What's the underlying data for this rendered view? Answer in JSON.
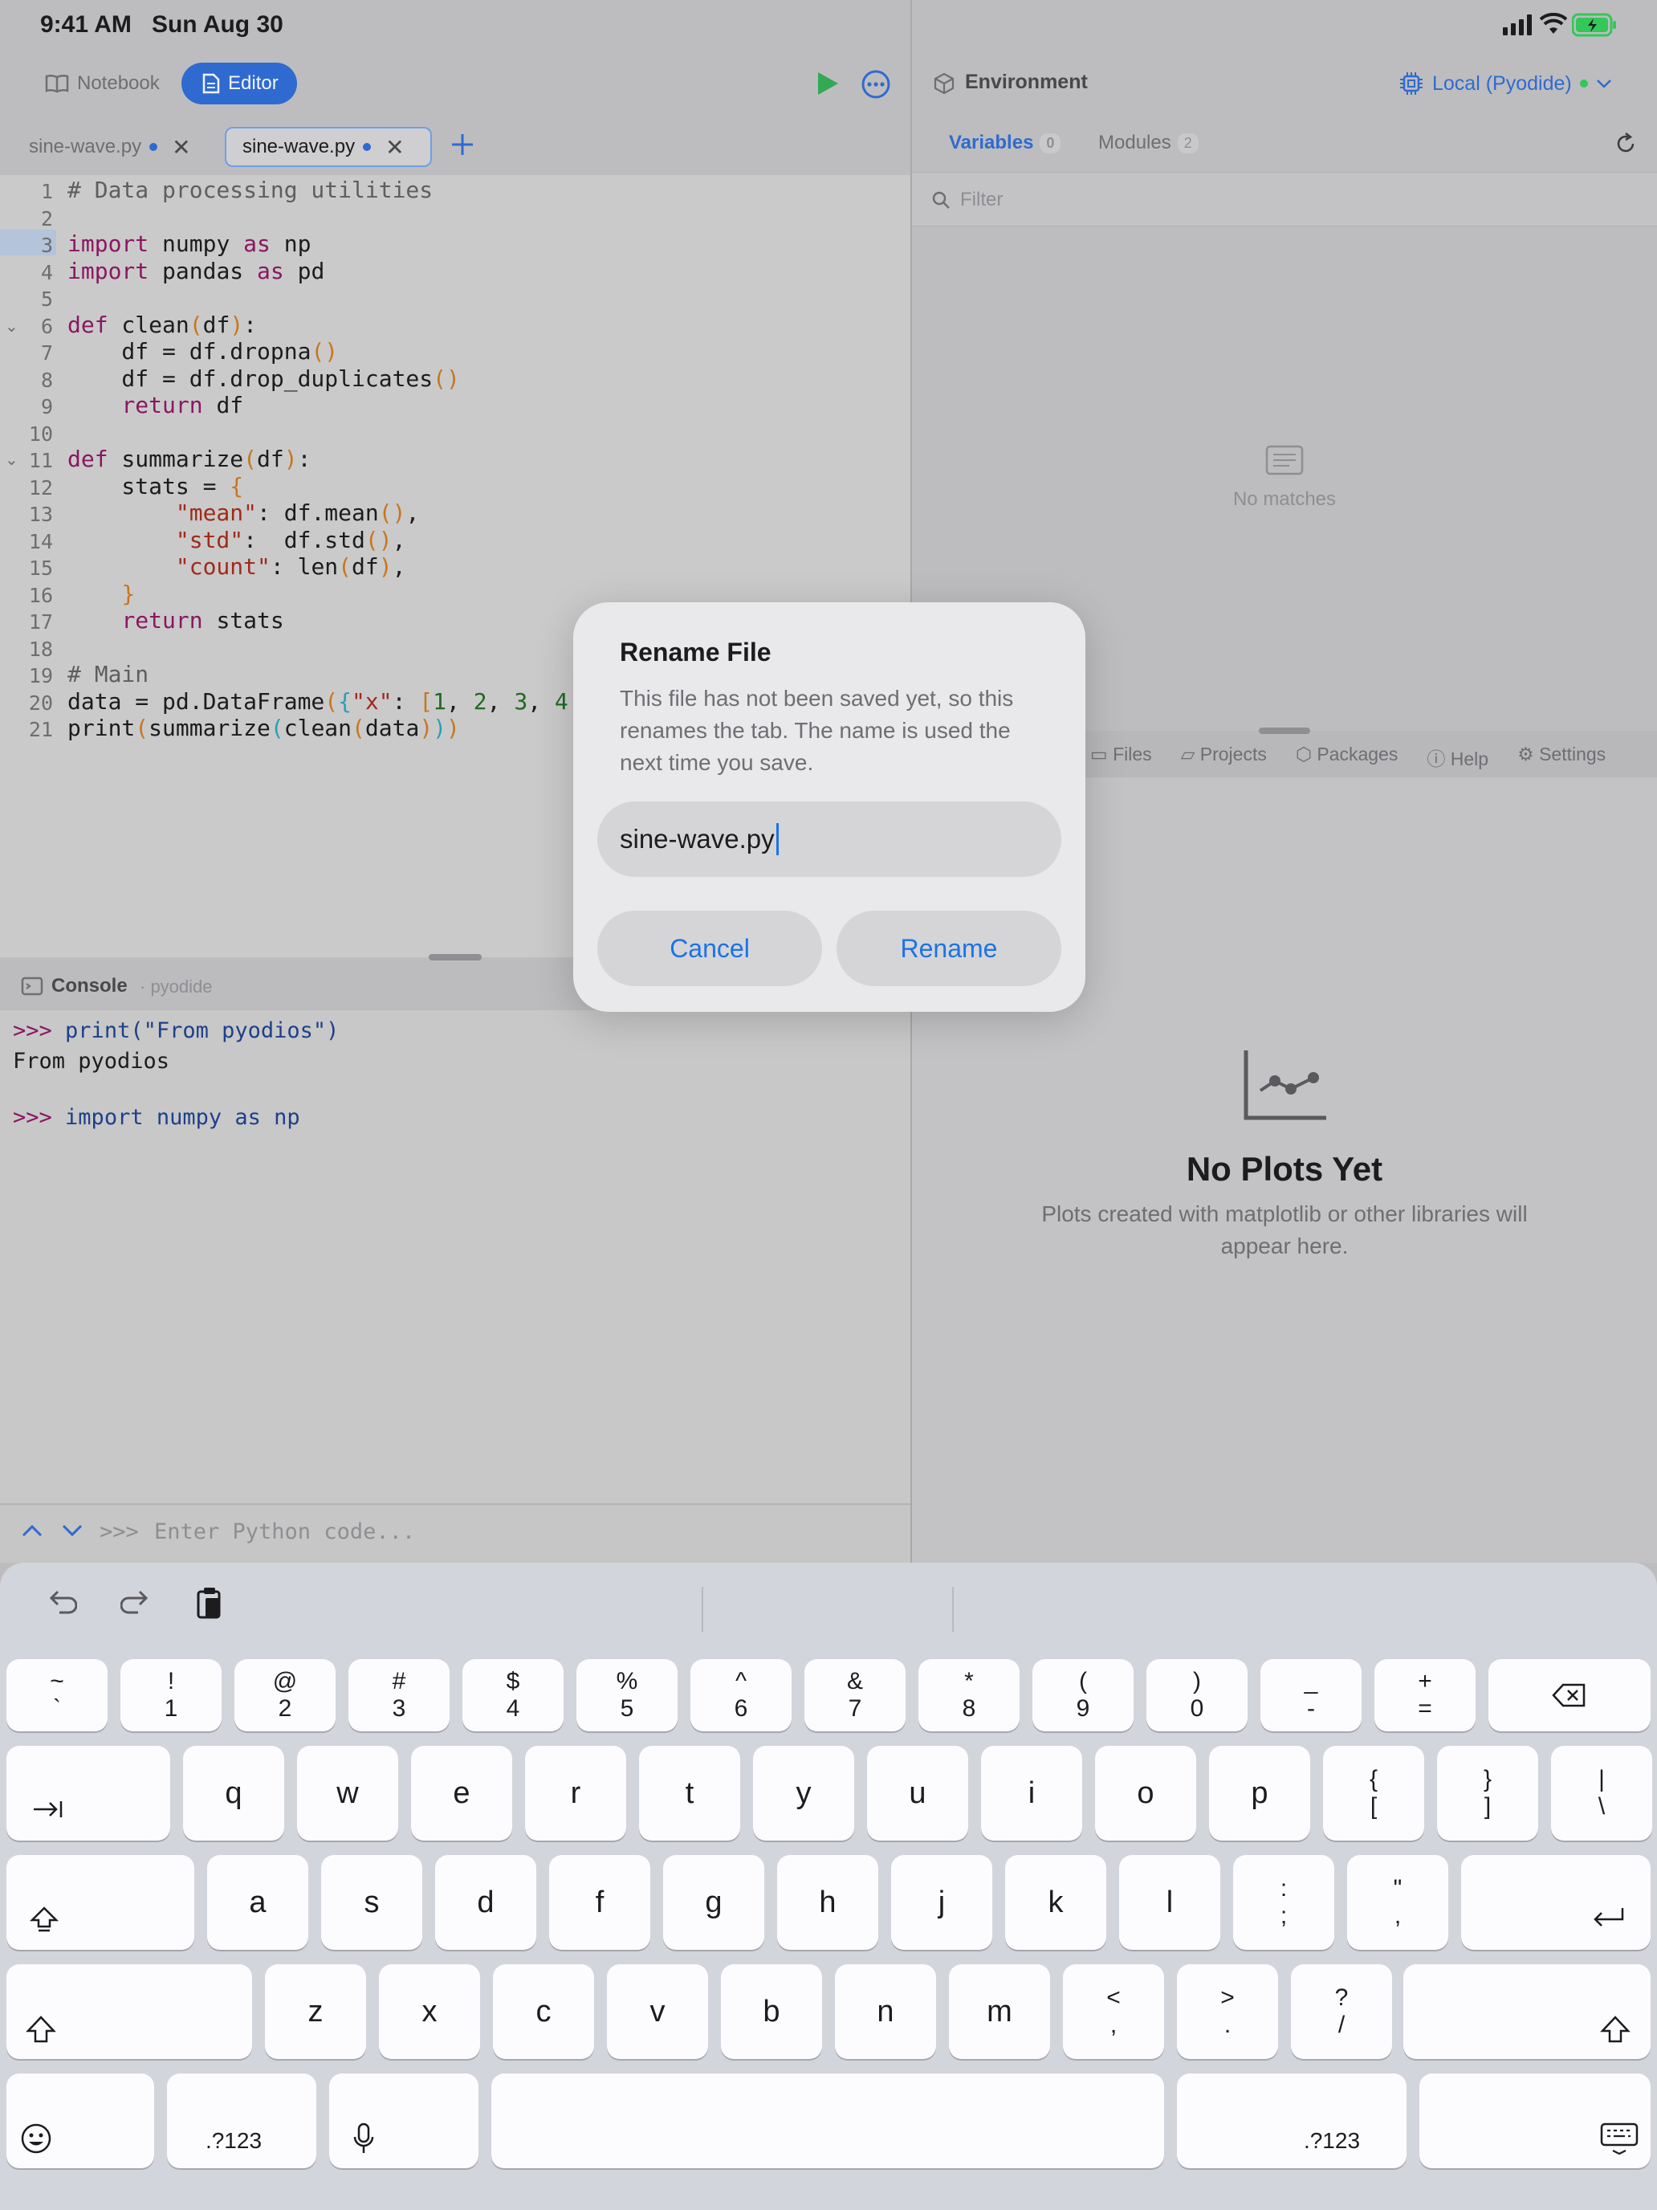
{
  "status_bar": {
    "time": "9:41 AM",
    "date": "Sun Aug 30"
  },
  "toolbar": {
    "notebook_label": "Notebook",
    "editor_label": "Editor"
  },
  "tabs": [
    {
      "label": "sine-wave.py",
      "unsaved": true,
      "active": false
    },
    {
      "label": "sine-wave.py",
      "unsaved": true,
      "active": true
    }
  ],
  "editor": {
    "line_numbers": [
      "1",
      "2",
      "3",
      "4",
      "5",
      "6",
      "7",
      "8",
      "9",
      "10",
      "11",
      "12",
      "13",
      "14",
      "15",
      "16",
      "17",
      "18",
      "19",
      "20",
      "21"
    ],
    "lines": [
      "# Data processing utilities",
      "",
      "import numpy as np",
      "import pandas as pd",
      "",
      "def clean(df):",
      "    df = df.dropna()",
      "    df = df.drop_duplicates()",
      "    return df",
      "",
      "def summarize(df):",
      "    stats = {",
      "        \"mean\": df.mean(),",
      "        \"std\":  df.std(),",
      "        \"count\": len(df),",
      "    }",
      "    return stats",
      "",
      "# Main",
      "data = pd.DataFrame({\"x\": [1, 2, 3, 4",
      "print(summarize(clean(data)))"
    ],
    "current_line": 3
  },
  "console": {
    "title": "Console",
    "kernel": "· pyodide",
    "lines": [
      {
        "prompt": ">>>",
        "text": "print(\"From pyodios\")"
      },
      {
        "prompt": "",
        "text": "From pyodios"
      },
      {
        "prompt": ">>>",
        "text": "import numpy as np"
      }
    ],
    "input_prompt": ">>>",
    "input_placeholder": "Enter Python code..."
  },
  "environment": {
    "title": "Environment",
    "runtime": "Local (Pyodide)",
    "runtime_status_color": "#34c759",
    "variables_label": "Variables",
    "variables_count": "0",
    "modules_label": "Modules",
    "modules_count": "2",
    "filter_placeholder": "Filter",
    "empty_text": "No matches"
  },
  "bottom_tabs": [
    "Files",
    "Projects",
    "Packages",
    "Help",
    "Settings"
  ],
  "plots": {
    "title": "No Plots Yet",
    "message": "Plots created with matplotlib or other libraries will appear here."
  },
  "dialog": {
    "title": "Rename File",
    "message": "This file has not been saved yet, so this renames the tab. The name is used the next time you save.",
    "input_value": "sine-wave.py",
    "cancel_label": "Cancel",
    "confirm_label": "Rename"
  },
  "keyboard": {
    "row1": [
      [
        "~",
        "`"
      ],
      [
        "!",
        "1"
      ],
      [
        "@",
        "2"
      ],
      [
        "#",
        "3"
      ],
      [
        "$",
        "4"
      ],
      [
        "%",
        "5"
      ],
      [
        "^",
        "6"
      ],
      [
        "&",
        "7"
      ],
      [
        "*",
        "8"
      ],
      [
        "(",
        "9"
      ],
      [
        ")",
        "0"
      ],
      [
        "_",
        "-"
      ],
      [
        "+",
        "="
      ]
    ],
    "row2": [
      "q",
      "w",
      "e",
      "r",
      "t",
      "y",
      "u",
      "i",
      "o",
      "p"
    ],
    "row2_extra": [
      [
        "{",
        "["
      ],
      [
        "}",
        "]"
      ],
      [
        "|",
        "\\"
      ]
    ],
    "row3": [
      "a",
      "s",
      "d",
      "f",
      "g",
      "h",
      "j",
      "k",
      "l"
    ],
    "row3_extra": [
      [
        ":",
        ";"
      ],
      [
        "\"",
        ","
      ]
    ],
    "row4": [
      "z",
      "x",
      "c",
      "v",
      "b",
      "n",
      "m"
    ],
    "row4_extra": [
      [
        "<",
        ","
      ],
      [
        ">",
        "."
      ],
      [
        "?",
        "/"
      ]
    ],
    "numbers_label": ".?123"
  },
  "colors": {
    "accent": "#2f6ad0",
    "link": "#1a73e8",
    "run": "#34a853"
  }
}
